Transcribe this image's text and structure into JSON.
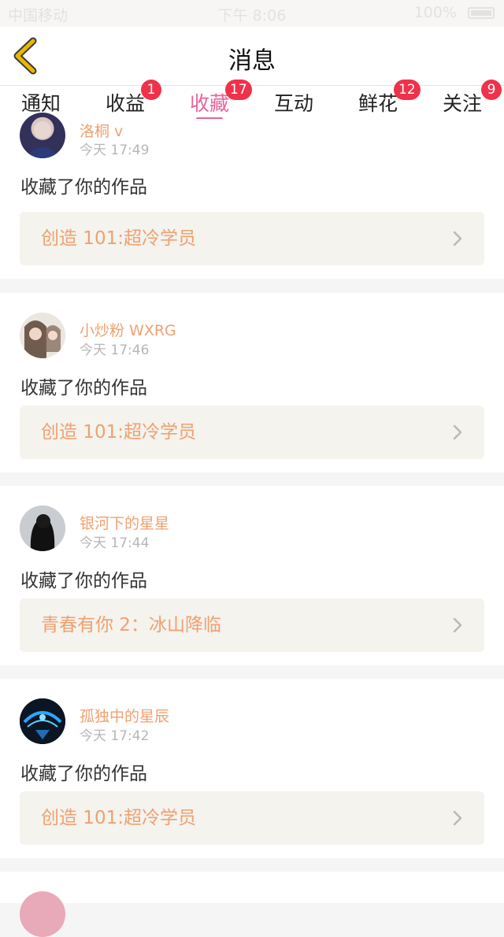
{
  "status_bar": {
    "carrier": "中国移动",
    "time": "下午 8:06",
    "battery": "100%"
  },
  "nav": {
    "title": "消息"
  },
  "tabs": [
    {
      "label": "通知",
      "badge": ""
    },
    {
      "label": "收益",
      "badge": "1"
    },
    {
      "label": "收藏",
      "badge": "17",
      "active": true
    },
    {
      "label": "互动",
      "badge": ""
    },
    {
      "label": "鲜花",
      "badge": "12"
    },
    {
      "label": "关注",
      "badge": "9"
    }
  ],
  "colors": {
    "accent": "#e8649a",
    "badge": "#f0314a",
    "username": "#f0a070",
    "back_arrow": "#e8b800"
  },
  "items": [
    {
      "username": "洛桐 v",
      "time": "今天 17:49",
      "action": "收藏了你的作品",
      "work": "创造 101:超冷学员",
      "avatar": "avatar-icon"
    },
    {
      "username": "小炒粉 WXRG",
      "time": "今天 17:46",
      "action": "收藏了你的作品",
      "work": "创造 101:超冷学员",
      "avatar": "avatar-icon"
    },
    {
      "username": "银河下的星星",
      "time": "今天 17:44",
      "action": "收藏了你的作品",
      "work": "青春有你 2：冰山降临",
      "avatar": "avatar-icon"
    },
    {
      "username": "孤独中的星辰",
      "time": "今天 17:42",
      "action": "收藏了你的作品",
      "work": "创造 101:超冷学员",
      "avatar": "avatar-icon"
    }
  ]
}
